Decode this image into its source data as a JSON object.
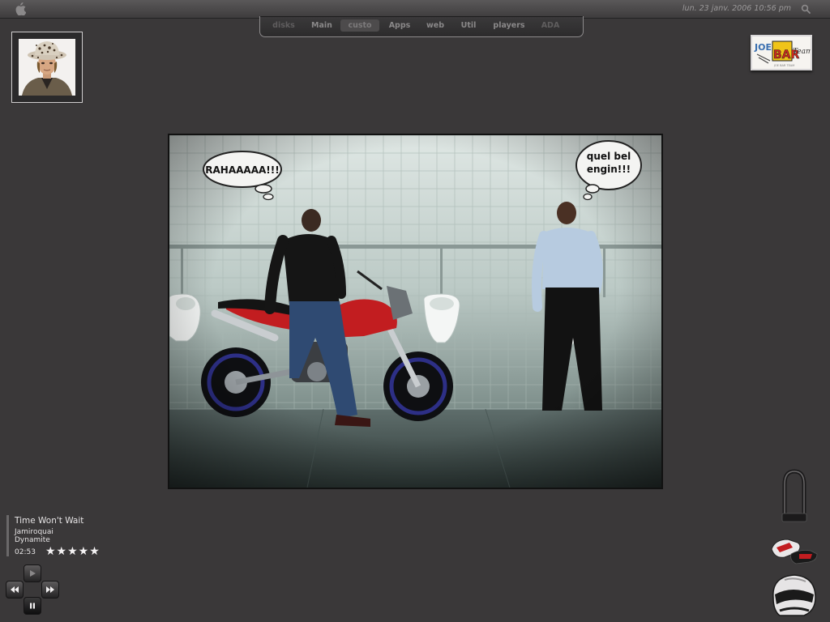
{
  "clock": {
    "text": "lun. 23 janv. 2006  10:56 pm"
  },
  "tabs": [
    {
      "label": "disks",
      "state": "dim"
    },
    {
      "label": "Main",
      "state": "normal"
    },
    {
      "label": "custo",
      "state": "active"
    },
    {
      "label": "Apps",
      "state": "normal"
    },
    {
      "label": "web",
      "state": "normal"
    },
    {
      "label": "Util",
      "state": "normal"
    },
    {
      "label": "players",
      "state": "normal"
    },
    {
      "label": "ADA",
      "state": "dim"
    }
  ],
  "photo": {
    "left_bubble": "RAHAAAAA!!!",
    "right_bubble_line1": "quel bel",
    "right_bubble_line2": "engin!!!"
  },
  "logo": {
    "text": "JOE BAR TEAM"
  },
  "now_playing": {
    "title": "Time Won't Wait",
    "artist": "Jamiroquai",
    "album": "Dynamite",
    "time": "02:53",
    "rating": 5,
    "stars": "★★★★★"
  },
  "icons": {
    "apple": "apple-icon",
    "search": "search-icon",
    "play": "play-icon",
    "rewind": "rewind-icon",
    "fast_forward": "fast-forward-icon",
    "pause": "pause-icon",
    "lock": "lock-icon",
    "gloves": "gloves-icon",
    "helmet": "helmet-icon"
  },
  "colors": {
    "desktop": "#3a3839",
    "bike_red": "#c21d20",
    "dock_border": "#8d8b8c"
  }
}
